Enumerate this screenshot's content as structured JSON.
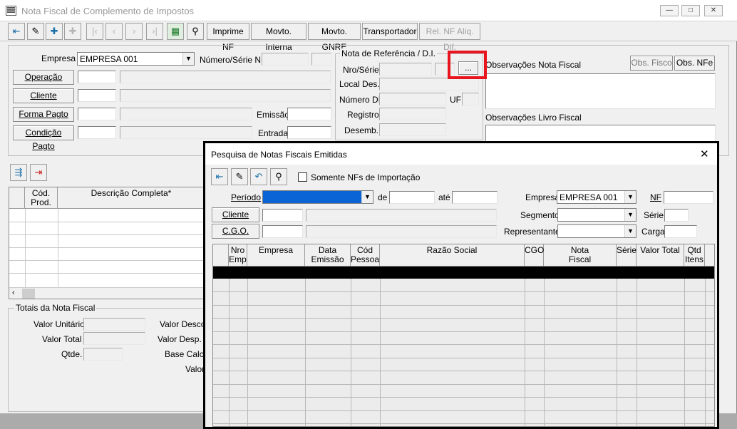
{
  "window": {
    "title": "Nota Fiscal de Complemento de Impostos",
    "controls": [
      "—",
      "□",
      "✕"
    ]
  },
  "toolbar": {
    "icons": [
      "exit-door-icon",
      "edit-pencil-icon",
      "add-document-icon",
      "insert-document-icon",
      "first-record-icon",
      "previous-record-icon",
      "next-record-icon",
      "last-record-icon",
      "calculator-grid-icon",
      "binoculars-icon"
    ],
    "buttons": [
      "Imprime NF",
      "Movto. Interna",
      "Movto. GNRE",
      "Transportador",
      "Rel. NF Aliq. Dif."
    ]
  },
  "form": {
    "empresa_label": "Empresa",
    "empresa_value": "EMPRESA 001",
    "numero_serie_label": "Número/Série NF",
    "operacao": "Operação",
    "cliente": "Cliente",
    "forma_pagto": "Forma Pagto",
    "condicao_pagto": "Condição Pagto",
    "emissao": "Emissão",
    "entrada": "Entrada"
  },
  "referencia": {
    "title": "Nota de Referência / D.I.",
    "nro_serie": "Nro/Série",
    "lookup_btn": "...",
    "local_des": "Local Des.",
    "numero_di": "Número DI",
    "uf": "UF",
    "registro": "Registro",
    "desemb": "Desemb."
  },
  "observacoes": {
    "nota_label": "Observações Nota Fiscal",
    "obs_fisco": "Obs. Fisco",
    "obs_nfe": "Obs. NFe",
    "livro_label": "Observações Livro Fiscal"
  },
  "items": {
    "columns": [
      "Cód.\nProd.",
      "Descrição Completa*"
    ]
  },
  "totais": {
    "title": "Totais da Nota Fiscal",
    "valor_unitario": "Valor Unitário",
    "valor_total": "Valor Total",
    "qtde": "Qtde.",
    "valor_desconto": "Valor Descon",
    "valor_desp": "Valor Desp. Ac",
    "base_calc": "Base Calc.",
    "valor": "Valor"
  },
  "dialog": {
    "title": "Pesquisa de Notas Fiscais Emitidas",
    "somente_import": "Somente NFs de Importação",
    "periodo": "Período",
    "de": "de",
    "ate": "até",
    "empresa": "Empresa",
    "empresa_value": "EMPRESA 001",
    "nf": "NF",
    "cliente": "Cliente",
    "segmento": "Segmento",
    "serie": "Série",
    "cgo": "C.G.O.",
    "representante": "Representante",
    "carga": "Carga",
    "columns": [
      "Nro\nEmp",
      "Empresa",
      "Data\nEmissão",
      "Cód\nPessoa",
      "Razão Social",
      "CGO",
      "Nota\nFiscal",
      "Série",
      "Valor Total",
      "Qtd\nItens"
    ]
  }
}
